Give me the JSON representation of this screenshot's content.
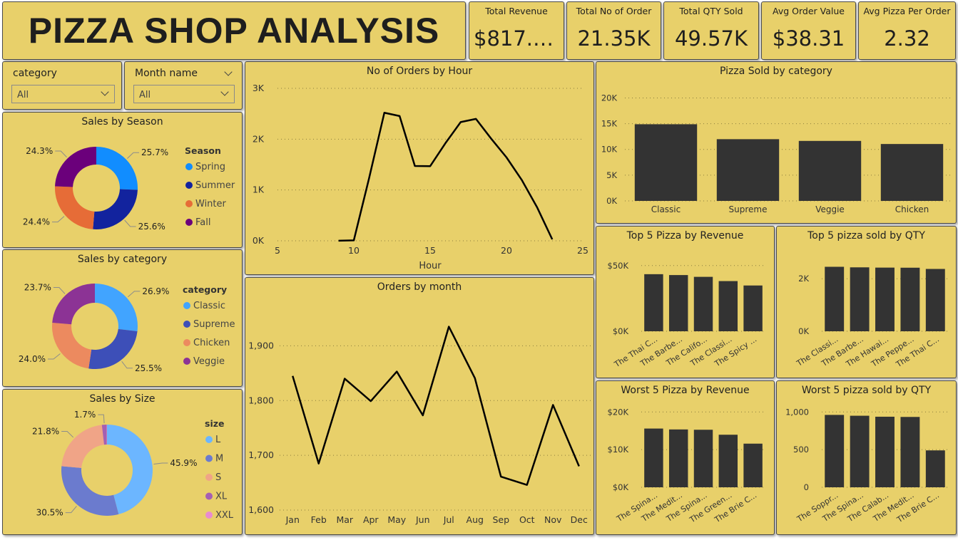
{
  "header": {
    "title": "PIZZA SHOP ANALYSIS"
  },
  "kpis": [
    {
      "label": "Total Revenue",
      "value": "$817.8..."
    },
    {
      "label": "Total No of Order",
      "value": "21.35K"
    },
    {
      "label": "Total QTY Sold",
      "value": "49.57K"
    },
    {
      "label": "Avg Order Value",
      "value": "$38.31"
    },
    {
      "label": "Avg Pizza Per Order",
      "value": "2.32"
    }
  ],
  "filters": {
    "category": {
      "label": "category",
      "selected": "All"
    },
    "month": {
      "label": "Month name",
      "selected": "All"
    }
  },
  "colors": {
    "panel": "#e8d06a",
    "bar": "#333333",
    "line": "#000000"
  },
  "chart_data": [
    {
      "id": "season",
      "type": "pie",
      "title": "Sales by Season",
      "legend_title": "Season",
      "slices": [
        {
          "name": "Spring",
          "value": 25.7,
          "label": "25.7%",
          "color": "#118dff"
        },
        {
          "name": "Summer",
          "value": 25.6,
          "label": "25.6%",
          "color": "#12239e"
        },
        {
          "name": "Winter",
          "value": 24.4,
          "label": "24.4%",
          "color": "#e66c37"
        },
        {
          "name": "Fall",
          "value": 24.3,
          "label": "24.3%",
          "color": "#6b007b"
        }
      ]
    },
    {
      "id": "category",
      "type": "pie",
      "title": "Sales by category",
      "legend_title": "category",
      "slices": [
        {
          "name": "Classic",
          "value": 26.9,
          "label": "26.9%",
          "color": "#41a4ff"
        },
        {
          "name": "Supreme",
          "value": 25.5,
          "label": "25.5%",
          "color": "#3d4fb8"
        },
        {
          "name": "Chicken",
          "value": 24.0,
          "label": "24.0%",
          "color": "#ec8a5f"
        },
        {
          "name": "Veggie",
          "value": 23.7,
          "label": "23.7%",
          "color": "#8c3395"
        }
      ]
    },
    {
      "id": "size",
      "type": "pie",
      "title": "Sales by Size",
      "legend_title": "size",
      "slices": [
        {
          "name": "L",
          "value": 45.9,
          "label": "45.9%",
          "color": "#6cb6ff"
        },
        {
          "name": "M",
          "value": 30.5,
          "label": "30.5%",
          "color": "#6b7bce"
        },
        {
          "name": "S",
          "value": 21.8,
          "label": "21.8%",
          "color": "#f0a487"
        },
        {
          "name": "XL",
          "value": 1.7,
          "label": "1.7%",
          "color": "#a55fb3"
        },
        {
          "name": "XXL",
          "value": 0.1,
          "label": "",
          "color": "#e88bd0"
        }
      ]
    },
    {
      "id": "hour",
      "type": "line",
      "title": "No of Orders by Hour",
      "xlabel": "Hour",
      "ylabel": "",
      "x": [
        9,
        10,
        11,
        12,
        13,
        14,
        15,
        16,
        17,
        18,
        19,
        20,
        21,
        22,
        23
      ],
      "values": [
        1,
        8,
        1231,
        2520,
        2455,
        1472,
        1468,
        1920,
        2336,
        2399,
        2009,
        1642,
        1198,
        663,
        28
      ],
      "xlim": [
        5,
        25
      ],
      "xticks": [
        "5",
        "10",
        "15",
        "20",
        "25"
      ],
      "ylim": [
        0,
        3000
      ],
      "yticks": [
        "0K",
        "1K",
        "2K",
        "3K"
      ]
    },
    {
      "id": "month",
      "type": "line",
      "title": "Orders by month",
      "xlabel": "",
      "ylabel": "",
      "categories": [
        "Jan",
        "Feb",
        "Mar",
        "Apr",
        "May",
        "Jun",
        "Jul",
        "Aug",
        "Sep",
        "Oct",
        "Nov",
        "Dec"
      ],
      "values": [
        1845,
        1685,
        1840,
        1799,
        1853,
        1773,
        1935,
        1841,
        1661,
        1646,
        1792,
        1680
      ],
      "ylim": [
        1600,
        1950
      ],
      "yticks": [
        "1,600",
        "1,700",
        "1,800",
        "1,900"
      ]
    },
    {
      "id": "cat_qty",
      "type": "bar",
      "title": "Pizza Sold by category",
      "categories": [
        "Classic",
        "Supreme",
        "Veggie",
        "Chicken"
      ],
      "values": [
        14888,
        11987,
        11649,
        11050
      ],
      "ylim": [
        0,
        22000
      ],
      "yticks": [
        "0K",
        "5K",
        "10K",
        "15K",
        "20K"
      ]
    },
    {
      "id": "top_rev",
      "type": "bar",
      "title": "Top 5 Pizza by Revenue",
      "categories": [
        "The Thai C...",
        "The Barbe...",
        "The Califo...",
        "The Classi...",
        "The Spicy ..."
      ],
      "values": [
        43434,
        42768,
        41410,
        38180,
        34831
      ],
      "ylim": [
        0,
        58000
      ],
      "yticks": [
        "$0K",
        "$50K"
      ]
    },
    {
      "id": "top_qty",
      "type": "bar",
      "title": "Top 5 pizza sold by QTY",
      "categories": [
        "The Classi...",
        "The Barbe...",
        "The Hawai...",
        "The Peppe...",
        "The Thai C..."
      ],
      "values": [
        2453,
        2432,
        2422,
        2418,
        2371
      ],
      "ylim": [
        0,
        2900
      ],
      "yticks": [
        "0K",
        "2K"
      ]
    },
    {
      "id": "worst_rev",
      "type": "bar",
      "title": "Worst 5 Pizza by Revenue",
      "categories": [
        "The Spina...",
        "The Medit...",
        "The Spina...",
        "The Green...",
        "The Brie C..."
      ],
      "values": [
        15596,
        15360,
        15278,
        13956,
        11588
      ],
      "ylim": [
        0,
        21000
      ],
      "yticks": [
        "$0K",
        "$10K",
        "$20K"
      ]
    },
    {
      "id": "worst_qty",
      "type": "bar",
      "title": "Worst 5 pizza sold by QTY",
      "categories": [
        "The Soppr...",
        "The Spina...",
        "The Calab...",
        "The Medit...",
        "The Brie C..."
      ],
      "values": [
        961,
        950,
        937,
        934,
        490
      ],
      "ylim": [
        0,
        1050
      ],
      "yticks": [
        "0",
        "500",
        "1,000"
      ]
    }
  ]
}
